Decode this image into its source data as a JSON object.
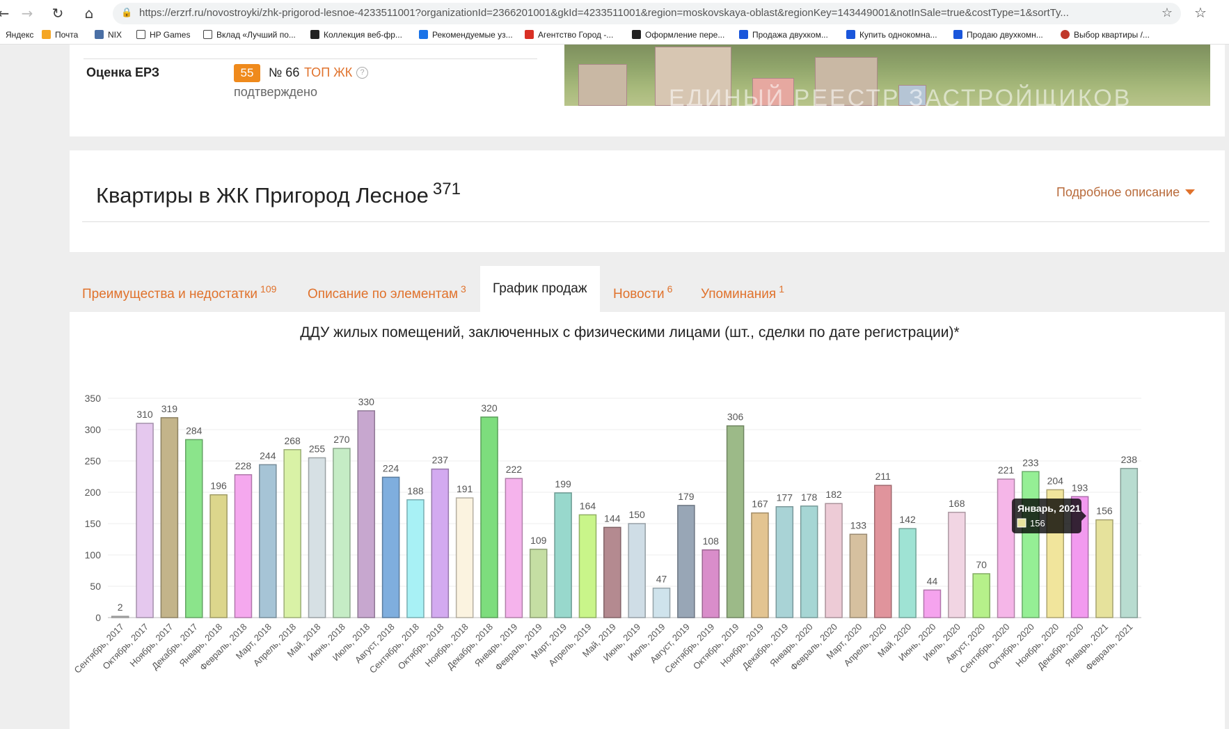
{
  "browser": {
    "url": "https://erzrf.ru/novostroyki/zhk-prigorod-lesnoe-4233511001?organizationId=2366201001&gkId=4233511001&region=moskovskaya-oblast&regionKey=143449001&notInSale=true&costType=1&sortTy...",
    "back_icon": "back-arrow-icon",
    "forward_icon": "forward-arrow-icon",
    "reload_icon": "reload-icon",
    "home_icon": "home-icon"
  },
  "bookmarks": [
    {
      "label": "Яндекс",
      "color": "#ffffff"
    },
    {
      "label": "Почта",
      "color": "#f5a623"
    },
    {
      "label": "NIX",
      "color": "#4a6fa5"
    },
    {
      "label": "HP Games",
      "color": "#ffffff"
    },
    {
      "label": "Вклад «Лучший по...",
      "color": "#ffffff"
    },
    {
      "label": "Коллекция веб-фр...",
      "color": "#222222"
    },
    {
      "label": "Рекомендуемые уз...",
      "color": "#1a73e8"
    },
    {
      "label": "Агентство Город -...",
      "color": "#d93025"
    },
    {
      "label": "Оформление пере...",
      "color": "#222222"
    },
    {
      "label": "Продажа двухком...",
      "color": "#1a56db"
    },
    {
      "label": "Купить однокомна...",
      "color": "#1a56db"
    },
    {
      "label": "Продаю двухкомн...",
      "color": "#1a56db"
    },
    {
      "label": "Выбор квартиры /...",
      "color": "#c0392b"
    }
  ],
  "info": {
    "rating_label": "Оценка ЕРЗ",
    "score": "55",
    "rank": "№ 66",
    "top_label": "ТОП ЖК",
    "help": "?",
    "status": "подтверждено",
    "hero_caption": "ЕДИНЫЙ РЕЕСТР ЗАСТРОЙЩИКОВ"
  },
  "section": {
    "title": "Квартиры в ЖК Пригород Лесное",
    "count": "371",
    "details_link": "Подробное описание"
  },
  "tabs": [
    {
      "label": "Преимущества и недостатки",
      "count": "109"
    },
    {
      "label": "Описание по элементам",
      "count": "3"
    },
    {
      "label": "График продаж",
      "count": ""
    },
    {
      "label": "Новости",
      "count": "6"
    },
    {
      "label": "Упоминания",
      "count": "1"
    }
  ],
  "chart_data": {
    "type": "bar",
    "title": "ДДУ жилых помещений, заключенных с физическими лицами (шт., сделки по дате регистрации)*",
    "ylim": [
      0,
      350
    ],
    "yticks": [
      0,
      50,
      100,
      150,
      200,
      250,
      300,
      350
    ],
    "categories": [
      "Сентябрь, 2017",
      "Октябрь, 2017",
      "Ноябрь, 2017",
      "Декабрь, 2017",
      "Январь, 2018",
      "Февраль, 2018",
      "Март, 2018",
      "Апрель, 2018",
      "Май, 2018",
      "Июнь, 2018",
      "Июль, 2018",
      "Август, 2018",
      "Сентябрь, 2018",
      "Октябрь, 2018",
      "Ноябрь, 2018",
      "Декабрь, 2018",
      "Январь, 2019",
      "Февраль, 2019",
      "Март, 2019",
      "Апрель, 2019",
      "Май, 2019",
      "Июнь, 2019",
      "Июль, 2019",
      "Август, 2019",
      "Сентябрь, 2019",
      "Октябрь, 2019",
      "Ноябрь, 2019",
      "Декабрь, 2019",
      "Январь, 2020",
      "Февраль, 2020",
      "Март, 2020",
      "Апрель, 2020",
      "Май, 2020",
      "Июнь, 2020",
      "Июль, 2020",
      "Август, 2020",
      "Сентябрь, 2020",
      "Октябрь, 2020",
      "Ноябрь, 2020",
      "Декабрь, 2020",
      "Январь, 2021",
      "Февраль, 2021"
    ],
    "values": [
      2,
      310,
      319,
      284,
      196,
      228,
      244,
      268,
      255,
      270,
      330,
      224,
      188,
      237,
      191,
      320,
      222,
      109,
      199,
      164,
      144,
      150,
      47,
      179,
      108,
      306,
      167,
      177,
      178,
      182,
      133,
      211,
      142,
      44,
      168,
      70,
      221,
      233,
      204,
      193,
      156,
      238
    ],
    "colors": [
      "#cfcfcf",
      "#e5c8ee",
      "#c3b48a",
      "#8be48b",
      "#dcd68c",
      "#f5a8ee",
      "#a6c4d6",
      "#d9f2a6",
      "#d6e0e4",
      "#c5ecc5",
      "#c7a7cf",
      "#7faede",
      "#a8f1f5",
      "#d3aaf0",
      "#fbf3e0",
      "#7ddd7d",
      "#f5b3ec",
      "#c5dea3",
      "#98d8cc",
      "#c9f58a",
      "#b48a90",
      "#cfdde6",
      "#cfe3ec",
      "#98a6b6",
      "#d98dca",
      "#9cba88",
      "#e3c491",
      "#a9d3d6",
      "#a6d6d4",
      "#edcbd6",
      "#d6c09f",
      "#e0949c",
      "#9fe3d4",
      "#f5a3ee",
      "#f1d5e3",
      "#b6f08a",
      "#f5b6e8",
      "#95ef95",
      "#f1e59c",
      "#f29aef",
      "#e6e29c",
      "#b8dcd0"
    ],
    "tooltip": {
      "label": "Январь, 2021",
      "value": "156"
    }
  }
}
